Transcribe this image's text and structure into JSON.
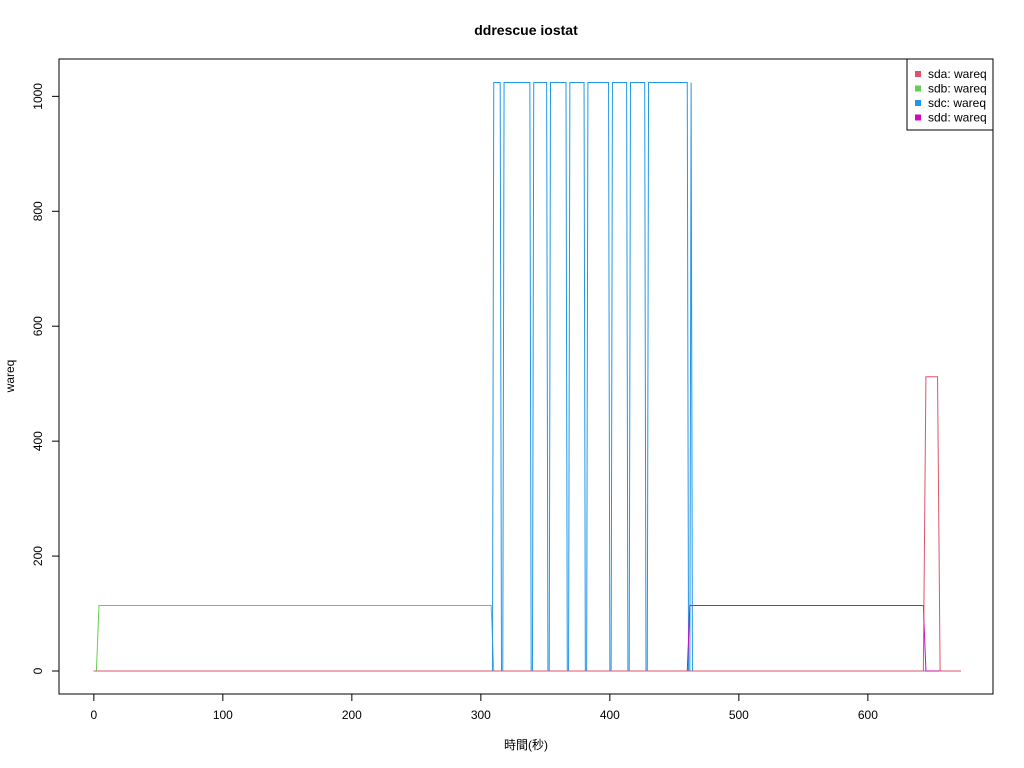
{
  "chart_data": {
    "type": "line",
    "title": "ddrescue iostat",
    "xlabel": "時間(秒)",
    "ylabel": "wareq",
    "xlim": [
      -27,
      697
    ],
    "ylim": [
      -40,
      1065
    ],
    "xticks": [
      0,
      100,
      200,
      300,
      400,
      500,
      600
    ],
    "yticks": [
      0,
      200,
      400,
      600,
      800,
      1000
    ],
    "grid": false,
    "legend_position": "top-right",
    "series": [
      {
        "name": "sda: wareq",
        "color": "#DF536B",
        "points": [
          [
            0,
            0
          ],
          [
            643,
            0
          ],
          [
            645,
            512
          ],
          [
            654,
            512
          ],
          [
            656,
            0
          ],
          [
            672,
            0
          ]
        ]
      },
      {
        "name": "sdb: wareq",
        "color": "#61D04F",
        "points": [
          [
            0,
            0
          ],
          [
            2,
            0
          ],
          [
            4,
            114
          ],
          [
            308,
            114
          ],
          [
            310,
            0
          ],
          [
            672,
            0
          ]
        ]
      },
      {
        "name": "sdc: wareq",
        "color": "#2297E6",
        "points": [
          [
            0,
            0
          ],
          [
            309,
            0
          ],
          [
            310,
            1024
          ],
          [
            315,
            1024
          ],
          [
            316,
            0
          ],
          [
            317,
            0
          ],
          [
            318,
            1024
          ],
          [
            338,
            1024
          ],
          [
            339,
            0
          ],
          [
            340,
            0
          ],
          [
            341,
            1024
          ],
          [
            351,
            1024
          ],
          [
            352,
            0
          ],
          [
            353,
            0
          ],
          [
            354,
            1024
          ],
          [
            366,
            1024
          ],
          [
            367,
            0
          ],
          [
            368,
            0
          ],
          [
            369,
            1024
          ],
          [
            380,
            1024
          ],
          [
            381,
            0
          ],
          [
            382,
            0
          ],
          [
            383,
            1024
          ],
          [
            399,
            1024
          ],
          [
            400,
            0
          ],
          [
            401,
            0
          ],
          [
            402,
            1024
          ],
          [
            413,
            1024
          ],
          [
            414,
            0
          ],
          [
            415,
            0
          ],
          [
            416,
            1024
          ],
          [
            427,
            1024
          ],
          [
            428,
            0
          ],
          [
            429,
            0
          ],
          [
            430,
            1024
          ],
          [
            460,
            1024
          ],
          [
            461,
            0
          ],
          [
            462,
            0
          ],
          [
            463,
            1024
          ],
          [
            464,
            0
          ],
          [
            672,
            0
          ]
        ]
      },
      {
        "name": "sdd: wareq",
        "color": "#CD0BBC",
        "points": [
          [
            0,
            0
          ],
          [
            460,
            0
          ],
          [
            462,
            114
          ],
          [
            643,
            114
          ],
          [
            645,
            0
          ],
          [
            672,
            0
          ]
        ]
      }
    ]
  }
}
